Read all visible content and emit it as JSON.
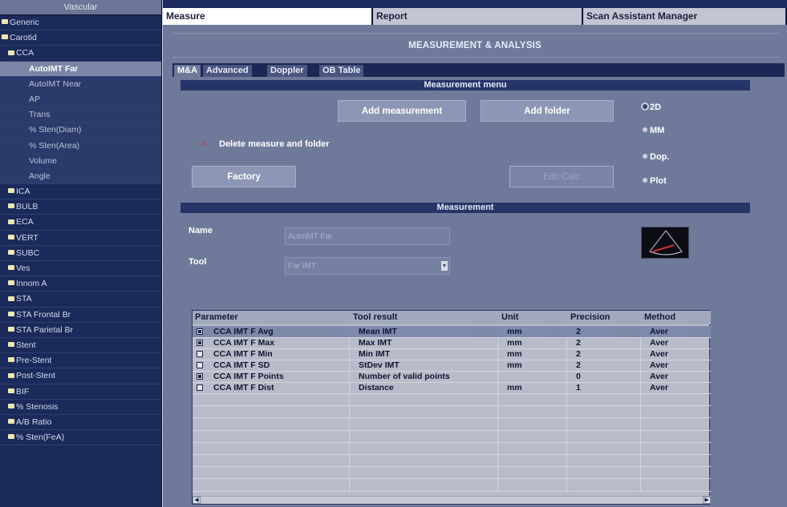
{
  "sidebar": {
    "title": "Vascular",
    "items": [
      {
        "label": "Generic",
        "level": 0,
        "kind": "folder"
      },
      {
        "label": "Carotid",
        "level": 0,
        "kind": "folder"
      },
      {
        "label": "CCA",
        "level": 1,
        "kind": "folder"
      },
      {
        "label": "AutoIMT Far",
        "level": 2,
        "kind": "leaf",
        "selected": true
      },
      {
        "label": "AutoIMT Near",
        "level": 2,
        "kind": "leaf"
      },
      {
        "label": "AP",
        "level": 2,
        "kind": "leaf"
      },
      {
        "label": "Trans",
        "level": 2,
        "kind": "leaf"
      },
      {
        "label": "% Sten(Diam)",
        "level": 2,
        "kind": "leaf"
      },
      {
        "label": "% Sten(Area)",
        "level": 2,
        "kind": "leaf"
      },
      {
        "label": "Volume",
        "level": 2,
        "kind": "leaf"
      },
      {
        "label": "Angle",
        "level": 2,
        "kind": "leaf"
      },
      {
        "label": "ICA",
        "level": 1,
        "kind": "folder"
      },
      {
        "label": "BULB",
        "level": 1,
        "kind": "folder"
      },
      {
        "label": "ECA",
        "level": 1,
        "kind": "folder"
      },
      {
        "label": "VERT",
        "level": 1,
        "kind": "folder"
      },
      {
        "label": "SUBC",
        "level": 1,
        "kind": "folder"
      },
      {
        "label": "Ves",
        "level": 1,
        "kind": "folder"
      },
      {
        "label": "Innom A",
        "level": 1,
        "kind": "folder"
      },
      {
        "label": "STA",
        "level": 1,
        "kind": "folder"
      },
      {
        "label": "STA Frontal Br",
        "level": 1,
        "kind": "folder"
      },
      {
        "label": "STA Parietal Br",
        "level": 1,
        "kind": "folder"
      },
      {
        "label": "Stent",
        "level": 1,
        "kind": "folder"
      },
      {
        "label": "Pre-Stent",
        "level": 1,
        "kind": "folder"
      },
      {
        "label": "Post-Stent",
        "level": 1,
        "kind": "folder"
      },
      {
        "label": "BIF",
        "level": 1,
        "kind": "folder"
      },
      {
        "label": "% Stenosis",
        "level": 1,
        "kind": "folder"
      },
      {
        "label": "A/B Ratio",
        "level": 1,
        "kind": "folder"
      },
      {
        "label": "% Sten(FeA)",
        "level": 1,
        "kind": "folder"
      }
    ]
  },
  "top_tabs": {
    "measure": "Measure",
    "report": "Report",
    "scan_assistant": "Scan Assistant Manager"
  },
  "section_title": "MEASUREMENT & ANALYSIS",
  "sub_tabs": {
    "ma": "M&A",
    "advanced": "Advanced",
    "doppler": "Doppler",
    "ob_table": "OB Table"
  },
  "measurement_menu": {
    "header": "Measurement menu",
    "add_measurement": "Add measurement",
    "add_folder": "Add folder",
    "delete": "Delete measure and folder",
    "factory": "Factory",
    "edit_calc": "Edit Calc",
    "modes": [
      "2D",
      "MM",
      "Dop.",
      "Plot"
    ],
    "selected_mode": "2D"
  },
  "measurement": {
    "header": "Measurement",
    "name_label": "Name",
    "name_value": "AutoIMT Far",
    "tool_label": "Tool",
    "tool_value": "Far IMT"
  },
  "table": {
    "columns": [
      "Parameter",
      "Tool result",
      "Unit",
      "Precision",
      "Method"
    ],
    "rows": [
      {
        "checked": true,
        "parameter": "CCA IMT F Avg",
        "tool_result": "Mean IMT",
        "unit": "mm",
        "precision": "2",
        "method": "Aver",
        "selected": true
      },
      {
        "checked": true,
        "parameter": "CCA IMT F Max",
        "tool_result": "Max IMT",
        "unit": "mm",
        "precision": "2",
        "method": "Aver"
      },
      {
        "checked": false,
        "parameter": "CCA IMT F Min",
        "tool_result": "Min IMT",
        "unit": "mm",
        "precision": "2",
        "method": "Aver"
      },
      {
        "checked": false,
        "parameter": "CCA IMT F SD",
        "tool_result": "StDev IMT",
        "unit": "mm",
        "precision": "2",
        "method": "Aver"
      },
      {
        "checked": true,
        "parameter": "CCA IMT F Points",
        "tool_result": "Number of valid points",
        "unit": "",
        "precision": "0",
        "method": "Aver"
      },
      {
        "checked": false,
        "parameter": "CCA IMT F Dist",
        "tool_result": "Distance",
        "unit": "mm",
        "precision": "1",
        "method": "Aver"
      }
    ]
  },
  "colors": {
    "sidebar_bg": "#1a2a5a",
    "selected_item": "#7b86a6",
    "content_bg": "#6f7a9a",
    "delete_icon": "#c83a3a"
  }
}
